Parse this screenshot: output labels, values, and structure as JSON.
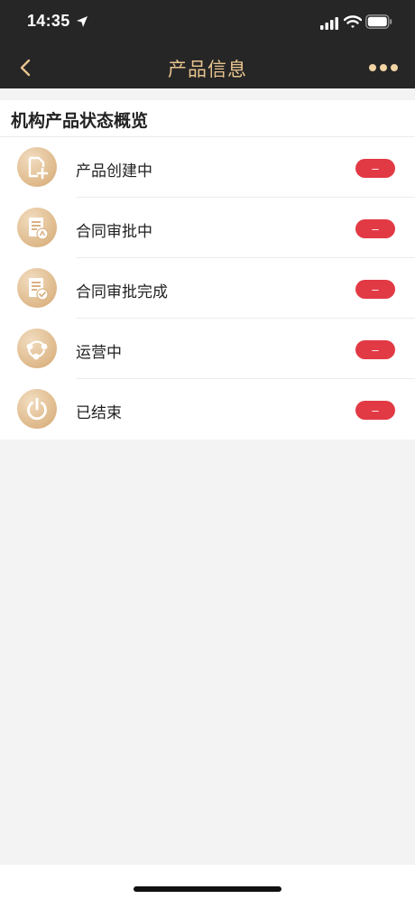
{
  "status_bar": {
    "time": "14:35",
    "icons": [
      "location-arrow-icon",
      "cellular-signal-icon",
      "wifi-icon",
      "battery-icon"
    ]
  },
  "nav": {
    "title": "产品信息",
    "back_icon": "chevron-left-icon",
    "more_icon": "more-dots-icon",
    "accent_color": "#e8c48f",
    "background_color": "#262626"
  },
  "section": {
    "title": "机构产品状态概览",
    "items": [
      {
        "label": "产品创建中",
        "badge": "–",
        "icon": "document-add-icon"
      },
      {
        "label": "合同审批中",
        "badge": "–",
        "icon": "contract-pending-icon"
      },
      {
        "label": "合同审批完成",
        "badge": "–",
        "icon": "contract-approved-icon"
      },
      {
        "label": "运营中",
        "badge": "–",
        "icon": "operation-network-icon"
      },
      {
        "label": "已结束",
        "badge": "–",
        "icon": "power-icon"
      }
    ]
  },
  "colors": {
    "badge": "#e23a45",
    "icon_gold": "#deb889",
    "page_background": "#f3f3f3"
  }
}
